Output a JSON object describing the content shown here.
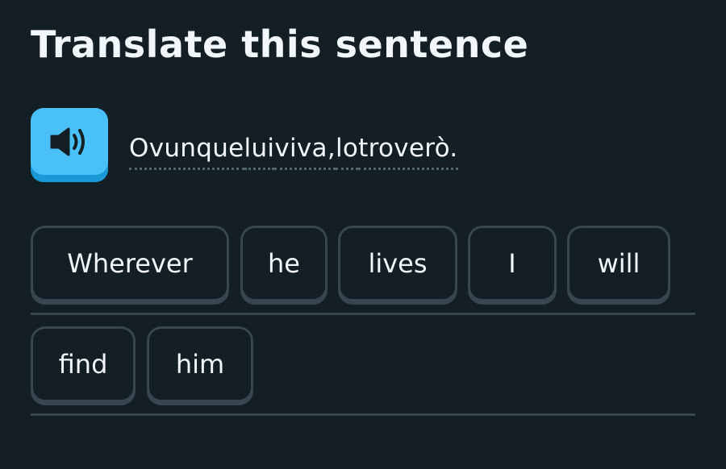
{
  "header": {
    "title": "Translate this sentence"
  },
  "prompt": {
    "words": [
      "Ovunque",
      "lui",
      "viva,",
      "lo",
      "troverò."
    ]
  },
  "answer": {
    "row1": [
      "Wherever",
      "he",
      "lives",
      "I",
      "will"
    ],
    "row2": [
      "find",
      "him"
    ]
  },
  "icons": {
    "audio": "speaker-icon"
  },
  "colors": {
    "background": "#131F24",
    "text": "#F1F7FB",
    "accent": "#49C0F8",
    "border": "#37464F"
  }
}
